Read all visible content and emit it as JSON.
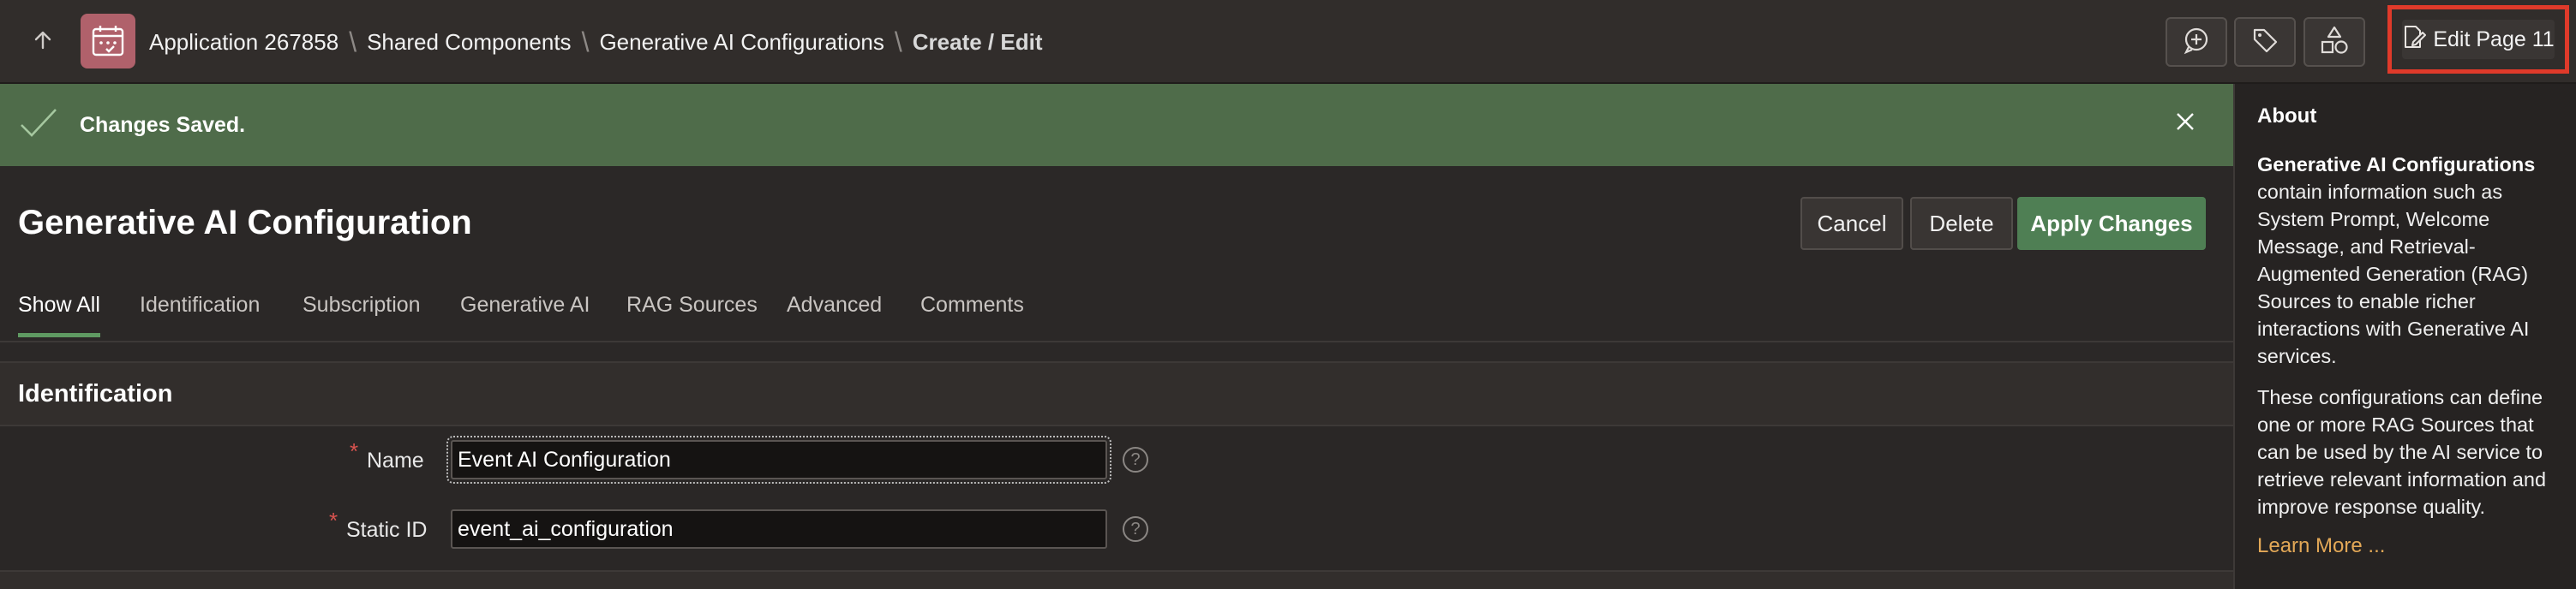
{
  "header": {
    "breadcrumbs": [
      "Application 267858",
      "Shared Components",
      "Generative AI Configurations",
      "Create / Edit"
    ],
    "edit_page_label": "Edit Page 11"
  },
  "banner": {
    "message": "Changes Saved."
  },
  "page": {
    "title": "Generative AI Configuration",
    "cancel_label": "Cancel",
    "delete_label": "Delete",
    "apply_label": "Apply Changes"
  },
  "tabs": [
    "Show All",
    "Identification",
    "Subscription",
    "Generative AI",
    "RAG Sources",
    "Advanced",
    "Comments"
  ],
  "section": {
    "title": "Identification"
  },
  "form": {
    "name_label": "Name",
    "name_value": "Event AI Configuration",
    "static_id_label": "Static ID",
    "static_id_value": "event_ai_configuration",
    "required_mark": "*",
    "help_glyph": "?"
  },
  "sidebar": {
    "heading": "About",
    "p1_bold": "Generative AI Configurations",
    "p1_rest": " contain information such as System Prompt, Welcome Message, and Retrieval-Augmented Generation (RAG) Sources to enable richer interactions with Generative AI services.",
    "p2": "These configurations can define one or more RAG Sources that can be used by the AI service to retrieve relevant information and improve response quality.",
    "learn_more": "Learn More ..."
  },
  "colors": {
    "accent_red_highlight": "#e03a2a",
    "success_banner": "#4f6c4a",
    "primary_button": "#4f7f54",
    "app_icon": "#b0616b",
    "link": "#e3a857"
  },
  "icons": [
    "arrow-up-icon",
    "calendar-app-icon",
    "chat-plus-icon",
    "tag-icon",
    "shapes-icon",
    "edit-page-icon",
    "check-icon",
    "close-icon",
    "help-icon"
  ]
}
